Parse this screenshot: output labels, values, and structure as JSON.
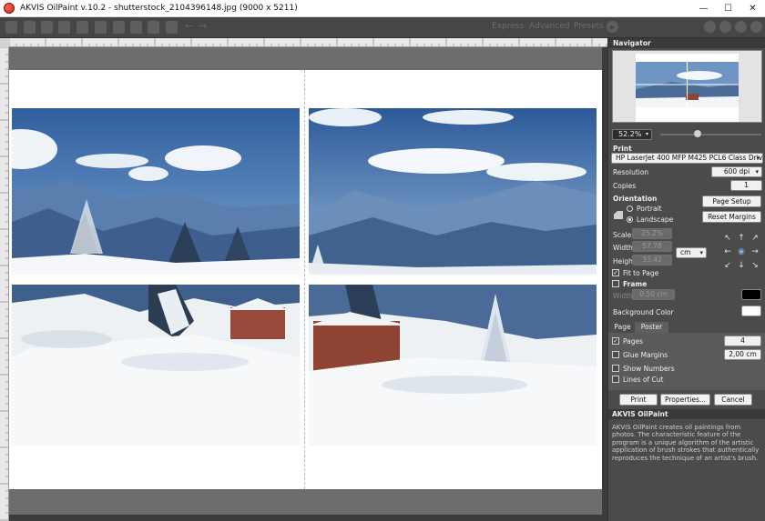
{
  "window": {
    "title": "AKVIS OilPaint v.10.2 - shutterstock_2104396148.jpg (9000 x 5211)",
    "minimize_glyph": "—",
    "maximize_glyph": "☐",
    "close_glyph": "✕"
  },
  "toolbar": {
    "modes": [
      "Express",
      "Advanced",
      "Presets"
    ],
    "left_icons": [
      "open-icon",
      "save-icon",
      "print-icon",
      "share-icon",
      "batch-icon",
      "before-after-icon",
      "brush-icon",
      "eraser-icon",
      "check-icon"
    ],
    "right_icons": [
      "info-icon",
      "help-icon",
      "settings-icon",
      "notifications-icon"
    ]
  },
  "navigator": {
    "header": "Navigator",
    "zoom": "52.2%"
  },
  "print": {
    "header": "Print",
    "printer": "HP LaserJet 400 MFP M425 PCL6 Class Driver",
    "resolution_label": "Resolution",
    "resolution_value": "600 dpi",
    "copies_label": "Copies",
    "copies_value": "1",
    "orientation_label": "Orientation",
    "portrait_label": "Portrait",
    "landscape_label": "Landscape",
    "orientation_selected": "Landscape",
    "page_setup_button": "Page Setup",
    "reset_margins_button": "Reset Margins",
    "scale_label": "Scale",
    "scale_value": "25.2%",
    "width_label": "Width",
    "width_value": "57.78",
    "height_label": "Height",
    "height_value": "33.42",
    "unit": "cm",
    "fit_to_page_label": "Fit to Page",
    "fit_to_page_checked": true,
    "frame_label": "Frame",
    "frame_checked": false,
    "frame_width_label": "Width",
    "frame_width_value": "0.50 cm",
    "frame_color": "#000000",
    "background_color_label": "Background Color",
    "background_color": "#ffffff"
  },
  "tabs": {
    "page_label": "Page",
    "poster_label": "Poster",
    "active": "Poster"
  },
  "poster": {
    "pages_label": "Pages",
    "pages_value": "4",
    "pages_checked": true,
    "glue_margins_label": "Glue Margins",
    "glue_margins_value": "2,00 cm",
    "glue_margins_checked": false,
    "show_numbers_label": "Show Numbers",
    "show_numbers_checked": false,
    "lines_of_cut_label": "Lines of Cut",
    "lines_of_cut_checked": false
  },
  "actions": {
    "print_button": "Print",
    "properties_button": "Properties...",
    "cancel_button": "Cancel"
  },
  "about": {
    "title": "AKVIS OilPaint",
    "description": "AKVIS OilPaint creates oil paintings from photos. The characteristic feature of the program is a unique algorithm of the artistic application of brush strokes that authentically reproduces the technique of an artist's brush."
  },
  "colors": {
    "panel_bg": "#4b4b4b",
    "header_bg": "#3a3a3a",
    "toolbar_bg": "#464646",
    "workspace_bg": "#6d6d6d"
  }
}
